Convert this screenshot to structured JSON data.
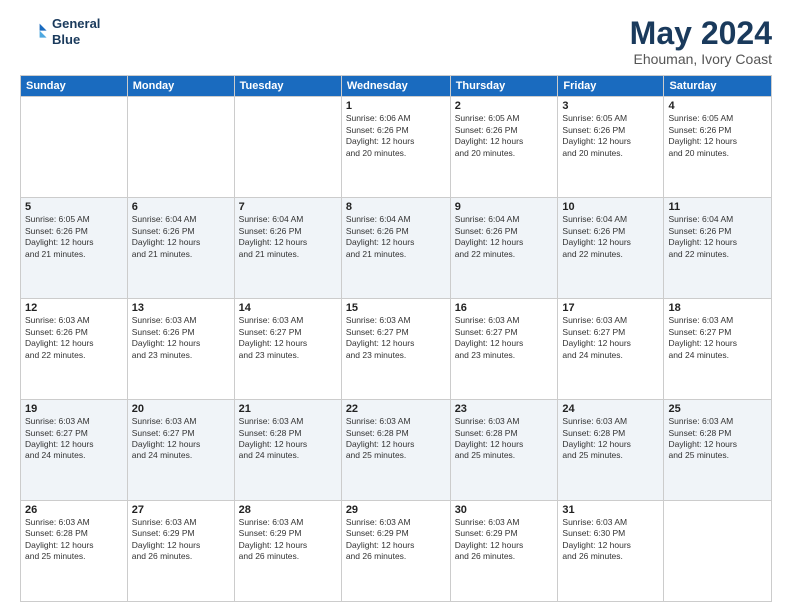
{
  "logo": {
    "line1": "General",
    "line2": "Blue"
  },
  "title": "May 2024",
  "location": "Ehouman, Ivory Coast",
  "weekdays": [
    "Sunday",
    "Monday",
    "Tuesday",
    "Wednesday",
    "Thursday",
    "Friday",
    "Saturday"
  ],
  "weeks": [
    [
      {
        "day": "",
        "info": ""
      },
      {
        "day": "",
        "info": ""
      },
      {
        "day": "",
        "info": ""
      },
      {
        "day": "1",
        "info": "Sunrise: 6:06 AM\nSunset: 6:26 PM\nDaylight: 12 hours\nand 20 minutes."
      },
      {
        "day": "2",
        "info": "Sunrise: 6:05 AM\nSunset: 6:26 PM\nDaylight: 12 hours\nand 20 minutes."
      },
      {
        "day": "3",
        "info": "Sunrise: 6:05 AM\nSunset: 6:26 PM\nDaylight: 12 hours\nand 20 minutes."
      },
      {
        "day": "4",
        "info": "Sunrise: 6:05 AM\nSunset: 6:26 PM\nDaylight: 12 hours\nand 20 minutes."
      }
    ],
    [
      {
        "day": "5",
        "info": "Sunrise: 6:05 AM\nSunset: 6:26 PM\nDaylight: 12 hours\nand 21 minutes."
      },
      {
        "day": "6",
        "info": "Sunrise: 6:04 AM\nSunset: 6:26 PM\nDaylight: 12 hours\nand 21 minutes."
      },
      {
        "day": "7",
        "info": "Sunrise: 6:04 AM\nSunset: 6:26 PM\nDaylight: 12 hours\nand 21 minutes."
      },
      {
        "day": "8",
        "info": "Sunrise: 6:04 AM\nSunset: 6:26 PM\nDaylight: 12 hours\nand 21 minutes."
      },
      {
        "day": "9",
        "info": "Sunrise: 6:04 AM\nSunset: 6:26 PM\nDaylight: 12 hours\nand 22 minutes."
      },
      {
        "day": "10",
        "info": "Sunrise: 6:04 AM\nSunset: 6:26 PM\nDaylight: 12 hours\nand 22 minutes."
      },
      {
        "day": "11",
        "info": "Sunrise: 6:04 AM\nSunset: 6:26 PM\nDaylight: 12 hours\nand 22 minutes."
      }
    ],
    [
      {
        "day": "12",
        "info": "Sunrise: 6:03 AM\nSunset: 6:26 PM\nDaylight: 12 hours\nand 22 minutes."
      },
      {
        "day": "13",
        "info": "Sunrise: 6:03 AM\nSunset: 6:26 PM\nDaylight: 12 hours\nand 23 minutes."
      },
      {
        "day": "14",
        "info": "Sunrise: 6:03 AM\nSunset: 6:27 PM\nDaylight: 12 hours\nand 23 minutes."
      },
      {
        "day": "15",
        "info": "Sunrise: 6:03 AM\nSunset: 6:27 PM\nDaylight: 12 hours\nand 23 minutes."
      },
      {
        "day": "16",
        "info": "Sunrise: 6:03 AM\nSunset: 6:27 PM\nDaylight: 12 hours\nand 23 minutes."
      },
      {
        "day": "17",
        "info": "Sunrise: 6:03 AM\nSunset: 6:27 PM\nDaylight: 12 hours\nand 24 minutes."
      },
      {
        "day": "18",
        "info": "Sunrise: 6:03 AM\nSunset: 6:27 PM\nDaylight: 12 hours\nand 24 minutes."
      }
    ],
    [
      {
        "day": "19",
        "info": "Sunrise: 6:03 AM\nSunset: 6:27 PM\nDaylight: 12 hours\nand 24 minutes."
      },
      {
        "day": "20",
        "info": "Sunrise: 6:03 AM\nSunset: 6:27 PM\nDaylight: 12 hours\nand 24 minutes."
      },
      {
        "day": "21",
        "info": "Sunrise: 6:03 AM\nSunset: 6:28 PM\nDaylight: 12 hours\nand 24 minutes."
      },
      {
        "day": "22",
        "info": "Sunrise: 6:03 AM\nSunset: 6:28 PM\nDaylight: 12 hours\nand 25 minutes."
      },
      {
        "day": "23",
        "info": "Sunrise: 6:03 AM\nSunset: 6:28 PM\nDaylight: 12 hours\nand 25 minutes."
      },
      {
        "day": "24",
        "info": "Sunrise: 6:03 AM\nSunset: 6:28 PM\nDaylight: 12 hours\nand 25 minutes."
      },
      {
        "day": "25",
        "info": "Sunrise: 6:03 AM\nSunset: 6:28 PM\nDaylight: 12 hours\nand 25 minutes."
      }
    ],
    [
      {
        "day": "26",
        "info": "Sunrise: 6:03 AM\nSunset: 6:28 PM\nDaylight: 12 hours\nand 25 minutes."
      },
      {
        "day": "27",
        "info": "Sunrise: 6:03 AM\nSunset: 6:29 PM\nDaylight: 12 hours\nand 26 minutes."
      },
      {
        "day": "28",
        "info": "Sunrise: 6:03 AM\nSunset: 6:29 PM\nDaylight: 12 hours\nand 26 minutes."
      },
      {
        "day": "29",
        "info": "Sunrise: 6:03 AM\nSunset: 6:29 PM\nDaylight: 12 hours\nand 26 minutes."
      },
      {
        "day": "30",
        "info": "Sunrise: 6:03 AM\nSunset: 6:29 PM\nDaylight: 12 hours\nand 26 minutes."
      },
      {
        "day": "31",
        "info": "Sunrise: 6:03 AM\nSunset: 6:30 PM\nDaylight: 12 hours\nand 26 minutes."
      },
      {
        "day": "",
        "info": ""
      }
    ]
  ]
}
